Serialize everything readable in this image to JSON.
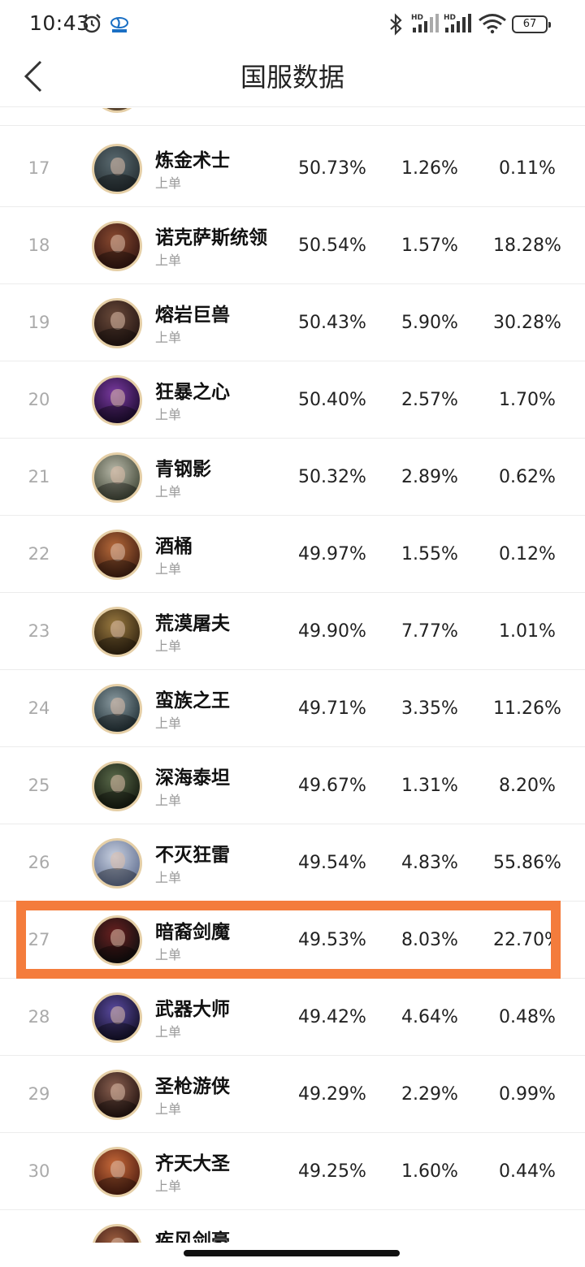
{
  "status_bar": {
    "time": "10:43",
    "battery": "67",
    "signal_1_label": "HD",
    "signal_2_label": "HD"
  },
  "header": {
    "title": "国服数据"
  },
  "rows": [
    {
      "rank": "",
      "name": "",
      "position": "",
      "win_rate": "",
      "pick_rate": "",
      "ban_rate": "",
      "colors": [
        "#3a2a2a",
        "#8a6a4a"
      ]
    },
    {
      "rank": "17",
      "name": "炼金术士",
      "position": "上单",
      "win_rate": "50.73%",
      "pick_rate": "1.26%",
      "ban_rate": "0.11%",
      "colors": [
        "#5a6a70",
        "#2a3438"
      ]
    },
    {
      "rank": "18",
      "name": "诺克萨斯统领",
      "position": "上单",
      "win_rate": "50.54%",
      "pick_rate": "1.57%",
      "ban_rate": "18.28%",
      "colors": [
        "#8a4a30",
        "#3a1a14"
      ]
    },
    {
      "rank": "19",
      "name": "熔岩巨兽",
      "position": "上单",
      "win_rate": "50.43%",
      "pick_rate": "5.90%",
      "ban_rate": "30.28%",
      "colors": [
        "#6a4a3a",
        "#2a1a16"
      ]
    },
    {
      "rank": "20",
      "name": "狂暴之心",
      "position": "上单",
      "win_rate": "50.40%",
      "pick_rate": "2.57%",
      "ban_rate": "1.70%",
      "colors": [
        "#7a3aa0",
        "#240e3a"
      ]
    },
    {
      "rank": "21",
      "name": "青钢影",
      "position": "上单",
      "win_rate": "50.32%",
      "pick_rate": "2.89%",
      "ban_rate": "0.62%",
      "colors": [
        "#b8b8a8",
        "#4a5040"
      ]
    },
    {
      "rank": "22",
      "name": "酒桶",
      "position": "上单",
      "win_rate": "49.97%",
      "pick_rate": "1.55%",
      "ban_rate": "0.12%",
      "colors": [
        "#b86a3a",
        "#4a2414"
      ]
    },
    {
      "rank": "23",
      "name": "荒漠屠夫",
      "position": "上单",
      "win_rate": "49.90%",
      "pick_rate": "7.77%",
      "ban_rate": "1.01%",
      "colors": [
        "#9a7a40",
        "#3a2a14"
      ]
    },
    {
      "rank": "24",
      "name": "蛮族之王",
      "position": "上单",
      "win_rate": "49.71%",
      "pick_rate": "3.35%",
      "ban_rate": "11.26%",
      "colors": [
        "#8a9aa0",
        "#2a3a40"
      ]
    },
    {
      "rank": "25",
      "name": "深海泰坦",
      "position": "上单",
      "win_rate": "49.67%",
      "pick_rate": "1.31%",
      "ban_rate": "8.20%",
      "colors": [
        "#5a6a4a",
        "#1a2014"
      ]
    },
    {
      "rank": "26",
      "name": "不灭狂雷",
      "position": "上单",
      "win_rate": "49.54%",
      "pick_rate": "4.83%",
      "ban_rate": "55.86%",
      "colors": [
        "#c8d0e0",
        "#6a7898"
      ]
    },
    {
      "rank": "27",
      "name": "暗裔剑魔",
      "position": "上单",
      "win_rate": "49.53%",
      "pick_rate": "8.03%",
      "ban_rate": "22.70%",
      "colors": [
        "#6a2020",
        "#141010"
      ]
    },
    {
      "rank": "28",
      "name": "武器大师",
      "position": "上单",
      "win_rate": "49.42%",
      "pick_rate": "4.64%",
      "ban_rate": "0.48%",
      "colors": [
        "#5a4aa0",
        "#181430"
      ]
    },
    {
      "rank": "29",
      "name": "圣枪游侠",
      "position": "上单",
      "win_rate": "49.29%",
      "pick_rate": "2.29%",
      "ban_rate": "0.99%",
      "colors": [
        "#8a6050",
        "#2a1814"
      ]
    },
    {
      "rank": "30",
      "name": "齐天大圣",
      "position": "上单",
      "win_rate": "49.25%",
      "pick_rate": "1.60%",
      "ban_rate": "0.44%",
      "colors": [
        "#c86a3a",
        "#5a2414"
      ]
    },
    {
      "rank": "",
      "name": "疾风剑豪",
      "position": "",
      "win_rate": "",
      "pick_rate": "",
      "ban_rate": "",
      "colors": [
        "#a06040",
        "#3a1a14"
      ]
    }
  ]
}
